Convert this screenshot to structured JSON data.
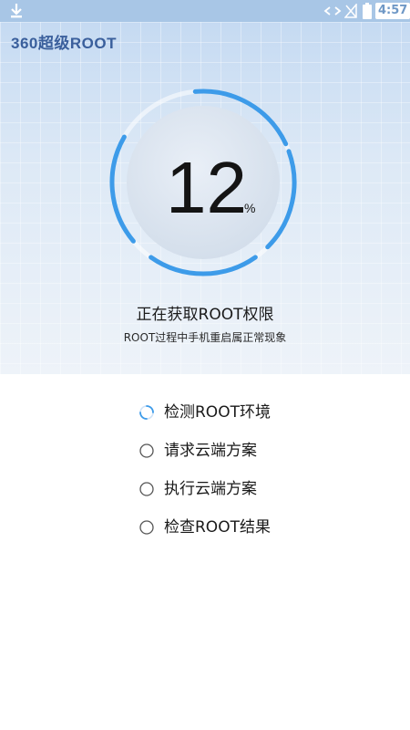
{
  "status_bar": {
    "time": "4:57",
    "icons": [
      "download-icon",
      "sync-arrows-icon",
      "no-signal-icon",
      "battery-icon"
    ]
  },
  "app": {
    "logo_text": "360超级ROOT"
  },
  "progress": {
    "value": "12",
    "unit": "%",
    "fraction": 0.12
  },
  "status": {
    "title": "正在获取ROOT权限",
    "subtitle": "ROOT过程中手机重启属正常现象"
  },
  "steps": [
    {
      "label": "检测ROOT环境",
      "state": "in-progress"
    },
    {
      "label": "请求云端方案",
      "state": "pending"
    },
    {
      "label": "执行云端方案",
      "state": "pending"
    },
    {
      "label": "检查ROOT结果",
      "state": "pending"
    }
  ],
  "colors": {
    "accent": "#3d9be9",
    "hero_top": "#c5daf2",
    "status_bar": "#a8c6e6"
  }
}
